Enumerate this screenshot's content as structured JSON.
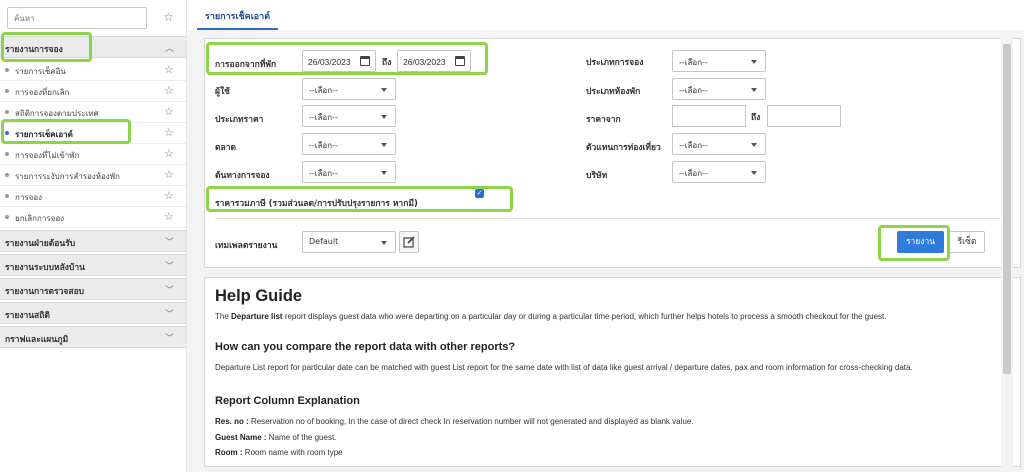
{
  "sidebar": {
    "search_placeholder": "ค้นหา",
    "sections": [
      {
        "label": "รายงานการจอง",
        "items": [
          {
            "label": "รายการเช็คอิน"
          },
          {
            "label": "การจองที่ยกเลิก"
          },
          {
            "label": "สถิติการจองตามประเทศ"
          },
          {
            "label": "รายการเช็คเอาต์",
            "active": true
          },
          {
            "label": "การจองที่ไม่เข้าพัก"
          },
          {
            "label": "รายการระงับการสำรองห้องพัก"
          },
          {
            "label": "การจอง"
          },
          {
            "label": "ยกเลิกการจอง"
          }
        ]
      },
      {
        "label": "รายงานฝ่ายต้อนรับ"
      },
      {
        "label": "รายงานระบบหลังบ้าน"
      },
      {
        "label": "รายงานการตรวจสอบ"
      },
      {
        "label": "รายงานสถิติ"
      },
      {
        "label": "กราฟและแผนภูมิ"
      }
    ]
  },
  "tab": {
    "label": "รายการเช็คเอาต์"
  },
  "form": {
    "departure_label": "การออกจากที่พัก",
    "date_from": "26/03/2023",
    "to_label": "ถึง",
    "date_to": "26/03/2023",
    "user_label": "ผู้ใช้",
    "rate_type_label": "ประเภทราคา",
    "market_label": "ตลาด",
    "source_label": "ต้นทางการจอง",
    "booking_type_label": "ประเภทการจอง",
    "room_type_label": "ประเภทห้องพัก",
    "rate_from_label": "ราคาจาก",
    "rate_to_label": "ถึง",
    "travel_agent_label": "ตัวแทนการท่องเที่ยว",
    "company_label": "บริษัท",
    "select_placeholder": "--เลือก--",
    "tax_inclusive_label": "ราคารวมภาษี (รวมส่วนลด/การปรับปรุงรายการ หากมี)",
    "template_label": "เทมเพลตรายงาน",
    "template_value": "Default",
    "report_button": "รายงาน",
    "reset_button": "รีเซ็ต"
  },
  "help": {
    "title": "Help Guide",
    "intro_bold": "Departure list",
    "intro_pre": "The ",
    "intro_post": " report displays guest data who were departing on a particular day or during a particular time period, which further helps hotels to process a smooth checkout for the guest.",
    "compare_heading": "How can you compare the report data with other reports?",
    "compare_text": "Departure List report for particular date can be matched with guest List report for the same date with list of data like guest arrival / departure dates, pax and room information for cross-checking data.",
    "columns_heading": "Report Column Explanation",
    "col1_label": "Res. no :",
    "col1_text": " Reservation no of booking, In the case of direct check In reservation number will not generated and displayed as blank value.",
    "col2_label": "Guest Name :",
    "col2_text": " Name of the guest.",
    "col3_label": "Room :",
    "col3_text": " Room name with room type"
  }
}
